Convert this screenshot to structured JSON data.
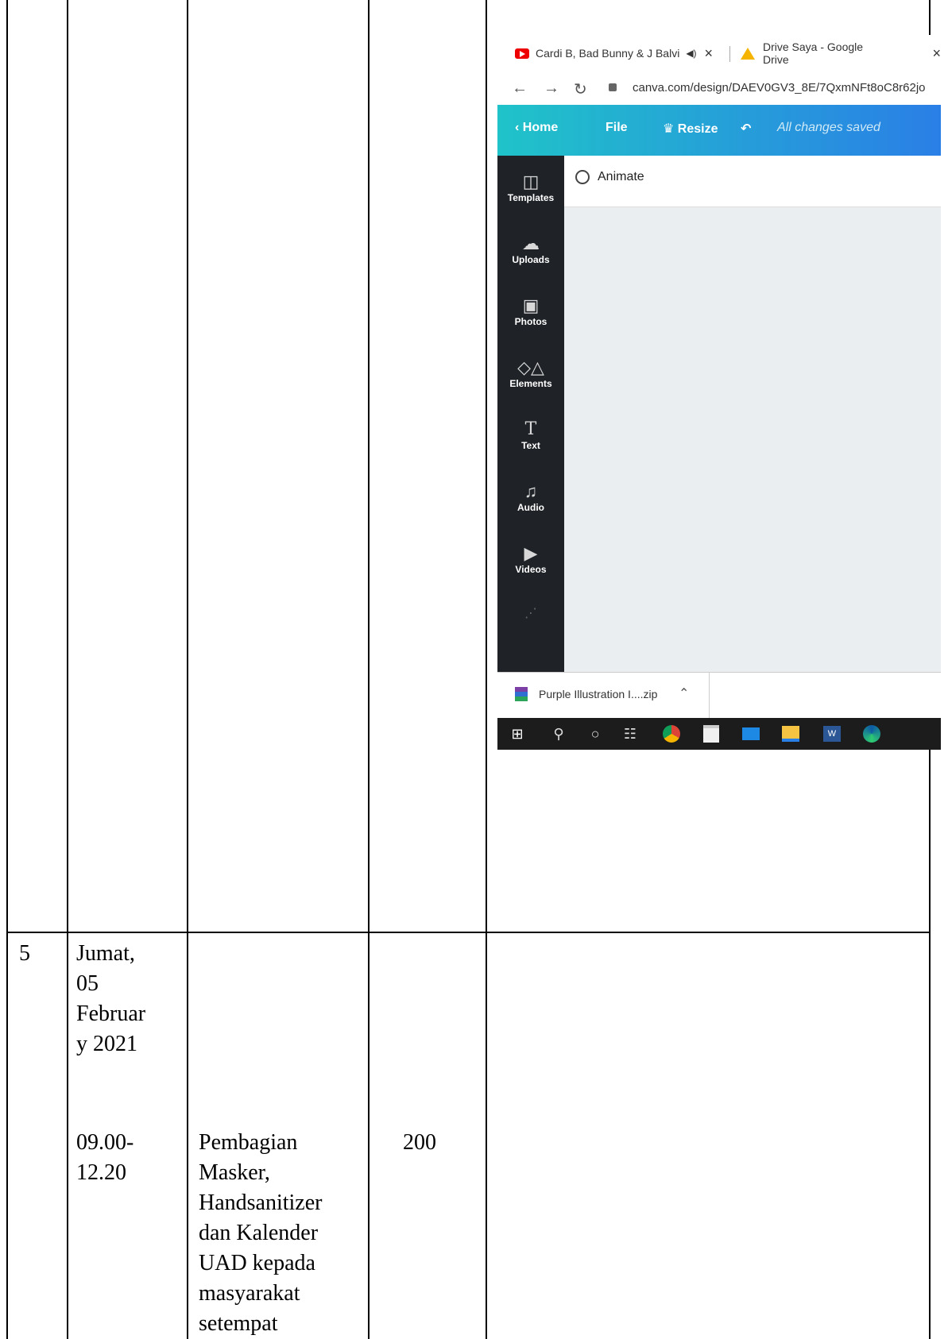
{
  "table": {
    "row5": {
      "number": "5",
      "day": "Jumat,\n05\nFebruar\ny 2021",
      "time": "09.00-\n12.20",
      "activity": "Pembagian\nMasker,\nHandsanitizer\ndan Kalender\nUAD kepada\nmasyarakat\nsetempat",
      "quantity": "200"
    }
  },
  "screenshot": {
    "tabs": [
      {
        "label": "Cardi B, Bad Bunny & J Balvi",
        "icon": "youtube-icon"
      },
      {
        "label": "Drive Saya - Google Drive",
        "icon": "google-drive-icon"
      }
    ],
    "tab_close": "×",
    "url": "canva.com/design/DAEV0GV3_8E/7QxmNFt8oC8r62jo",
    "toolbar": {
      "home": "Home",
      "file": "File",
      "resize": "Resize",
      "saved_status": "All changes saved"
    },
    "animate_label": "Animate",
    "sidebar": [
      {
        "label": "Templates",
        "icon": "templates-icon"
      },
      {
        "label": "Uploads",
        "icon": "upload-cloud-icon"
      },
      {
        "label": "Photos",
        "icon": "photo-icon"
      },
      {
        "label": "Elements",
        "icon": "shapes-icon"
      },
      {
        "label": "Text",
        "icon": "text-icon"
      },
      {
        "label": "Audio",
        "icon": "music-note-icon"
      },
      {
        "label": "Videos",
        "icon": "video-icon"
      }
    ],
    "download": {
      "filename": "Purple Illustration I....zip",
      "icon": "winrar-archive-icon"
    },
    "taskbar_icons": [
      "windows-start-icon",
      "search-icon",
      "cortana-icon",
      "task-view-icon",
      "chrome-icon",
      "store-icon",
      "mail-icon",
      "file-explorer-icon",
      "word-icon",
      "edge-icon"
    ],
    "colors": {
      "toolbar_start": "#20c3c9",
      "toolbar_end": "#2a7fe6",
      "sidebar": "#1f2328",
      "taskbar": "#1c1c1c"
    }
  }
}
